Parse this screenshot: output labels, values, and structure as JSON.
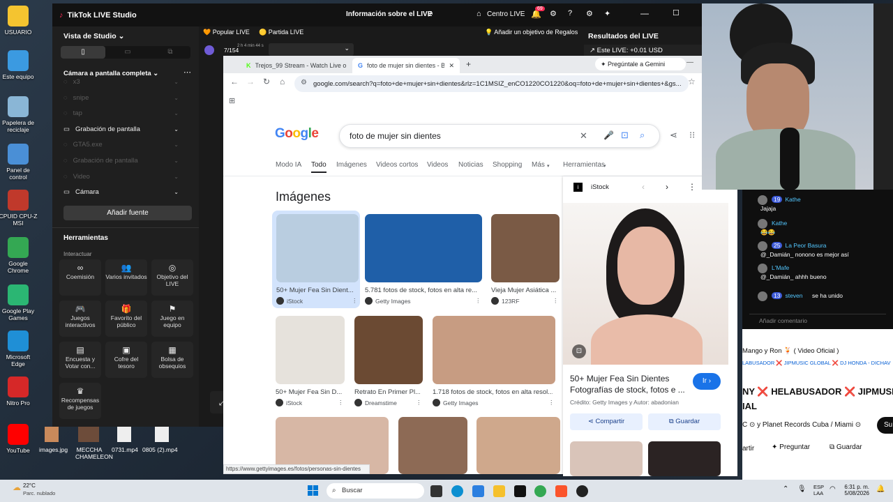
{
  "desktop_icons": [
    {
      "label": "USUARIO",
      "color": "#f4c430"
    },
    {
      "label": "Este equipo",
      "color": "#3b9ae1"
    },
    {
      "label": "Papelera de reciclaje",
      "color": "#8ab6d6"
    },
    {
      "label": "Panel de control",
      "color": "#4a8fd6"
    },
    {
      "label": "CPUID CPU-Z MSI",
      "color": "#c0392b"
    },
    {
      "label": "Google Chrome",
      "color": "#34a853"
    },
    {
      "label": "Google Play Games",
      "color": "#2bb673"
    },
    {
      "label": "Microsoft Edge",
      "color": "#1f8fd6"
    },
    {
      "label": "Nitro Pro",
      "color": "#d62828"
    },
    {
      "label": "YouTube",
      "color": "#ff0000"
    }
  ],
  "desktop_files": [
    "images.jpg",
    "MECCHA CHAMELEON",
    "0731.mp4",
    "0805 (2).mp4"
  ],
  "tiktok": {
    "title": "TikTok LIVE Studio",
    "info": "Información sobre el LIVE",
    "center": "Centro LIVE",
    "badge": "69",
    "view_label": "Vista de Studio",
    "scene": "Cámara a pantalla completa",
    "sources": [
      {
        "label": "x3",
        "active": false
      },
      {
        "label": "snipe",
        "active": false
      },
      {
        "label": "tap",
        "active": false
      },
      {
        "label": "Grabación de pantalla",
        "active": true
      },
      {
        "label": "GTA5.exe",
        "active": false
      },
      {
        "label": "Grabación de pantalla",
        "active": false
      },
      {
        "label": "Video",
        "active": false
      },
      {
        "label": "Cámara",
        "active": true
      }
    ],
    "add_source": "Añadir fuente",
    "tools_title": "Herramientas",
    "interact": "Interactuar",
    "tools": [
      {
        "label": "Coemisión",
        "glyph": "∞"
      },
      {
        "label": "Varios invitados",
        "glyph": "👥"
      },
      {
        "label": "Objetivo del LIVE",
        "glyph": "◎"
      },
      {
        "label": "Juegos interactivos",
        "glyph": "🎮"
      },
      {
        "label": "Favorito del público",
        "glyph": "🎁"
      },
      {
        "label": "Juego en equipo",
        "glyph": "⚑"
      },
      {
        "label": "Encuesta y Votar con...",
        "glyph": "▤"
      },
      {
        "label": "Cofre del tesoro",
        "glyph": "▣"
      },
      {
        "label": "Bolsa de obsequios",
        "glyph": "▦"
      },
      {
        "label": "Recompensas de juegos",
        "glyph": "♛"
      }
    ],
    "popular": "Popular LIVE",
    "partida": "Partida LIVE",
    "goal": "Añadir un objetivo de Regalos",
    "results": "Resultados del LIVE",
    "este_live": "Este LIVE: +0.01 USD",
    "progress": "7/154",
    "timer": "2 h 4 min 44 s"
  },
  "browser": {
    "tabs": [
      {
        "label": "Trejos_99 Stream - Watch Live o",
        "active": false
      },
      {
        "label": "foto de mujer sin dientes - Busc",
        "active": true
      }
    ],
    "gemini": "Pregúntale a Gemini",
    "url": "google.com/search?q=foto+de+mujer+sin+dientes&rlz=1C1MSIZ_enCO1220CO1220&oq=foto+de+mujer+sin+dientes+&gs...",
    "logo": "Google",
    "query": "foto de mujer sin dientes",
    "nav": [
      "Modo IA",
      "Todo",
      "Imágenes",
      "Videos cortos",
      "Videos",
      "Noticias",
      "Shopping",
      "Más",
      "Herramientas"
    ],
    "section": "Imágenes",
    "results": [
      {
        "caption": "50+ Mujer Fea Sin Dient...",
        "source": "iStock",
        "color": "#b9cde0"
      },
      {
        "caption": "5.781 fotos de stock, fotos en alta re...",
        "source": "Getty Images",
        "color": "#1f5fa8"
      },
      {
        "caption": "Vieja Mujer Asiática ...",
        "source": "123RF",
        "color": "#7a5a45"
      },
      {
        "caption": "50+ Mujer Fea Sin D...",
        "source": "iStock",
        "color": "#e6e2dc"
      },
      {
        "caption": "Retrato En Primer Pl...",
        "source": "Dreamstime",
        "color": "#6b4a33"
      },
      {
        "caption": "1.718 fotos de stock, fotos en alta resol...",
        "source": "Getty Images",
        "color": "#c79c82"
      }
    ],
    "status_url": "https://www.gettyimages.es/fotos/personas-sin-dientes",
    "preview": {
      "source": "iStock",
      "title": "50+ Mujer Fea Sin Dientes Fotografías de stock, fotos e ...",
      "go": "Ir",
      "credit": "Crédito: Getty Images y Autor: abadonian",
      "share": "Compartir",
      "save": "Guardar"
    }
  },
  "chat": {
    "messages": [
      {
        "user": "Kathe",
        "level": "19",
        "text": "Jajaja"
      },
      {
        "user": "Kathe",
        "level": "",
        "text": "😂😂"
      },
      {
        "user": "La Peor Basura",
        "level": "25",
        "text": "@_Damián_ nonono es mejor así"
      },
      {
        "user": "L'Mafe",
        "level": "",
        "text": "@_Damián_ ahhh bueno"
      },
      {
        "user": "steven",
        "level": "13",
        "text": "se ha unido"
      }
    ],
    "input": "Añadir comentario",
    "song": "Mango y Ron 🍹 ( Video Oficial )",
    "song_sub": "LABUSADOR ❌ JIPMUSIC GLOBAL ❌ DJ HONDA - DICHAV",
    "headline": "NY ❌ HELABUSADOR ❌ JIPMUSIC",
    "headline2": "IAL",
    "channel": "C ⊙ y Planet Records Cuba / Miami ⊙",
    "actions": [
      "artir",
      "Preguntar",
      "Guardar"
    ],
    "subscribe": "Su"
  },
  "taskbar": {
    "weather": "22°C",
    "weather_sub": "Parc. nublado",
    "search": "Buscar",
    "lang": "ESP",
    "lang2": "LAA",
    "time": "6:31 p. m.",
    "date": "5/08/2026"
  }
}
